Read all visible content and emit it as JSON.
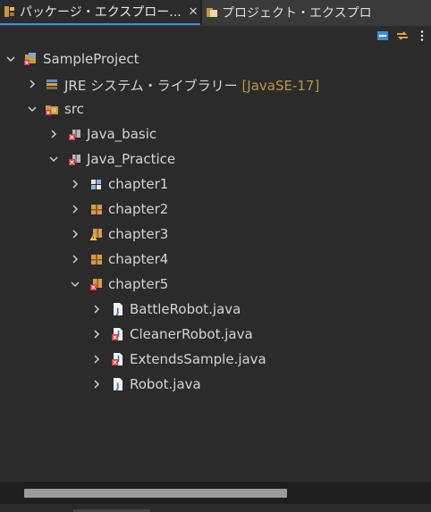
{
  "tabs": [
    {
      "label": "パッケージ・エクスプロー...",
      "close": "✕",
      "active": true
    },
    {
      "label": "プロジェクト・エクスプロ",
      "active": false
    }
  ],
  "tree": {
    "project": "SampleProject",
    "jre": {
      "label": "JRE システム・ライブラリー",
      "decoration": "[JavaSE-17]"
    },
    "src": "src",
    "java_basic": "Java_basic",
    "java_practice": "Java_Practice",
    "chapter1": "chapter1",
    "chapter2": "chapter2",
    "chapter3": "chapter3",
    "chapter4": "chapter4",
    "chapter5": "chapter5",
    "files": [
      "BattleRobot.java",
      "CleanerRobot.java",
      "ExtendsSample.java",
      "Robot.java"
    ]
  },
  "colors": {
    "accent": "#3c8dde",
    "decoration": "#b8964f",
    "error": "#d9343a"
  }
}
